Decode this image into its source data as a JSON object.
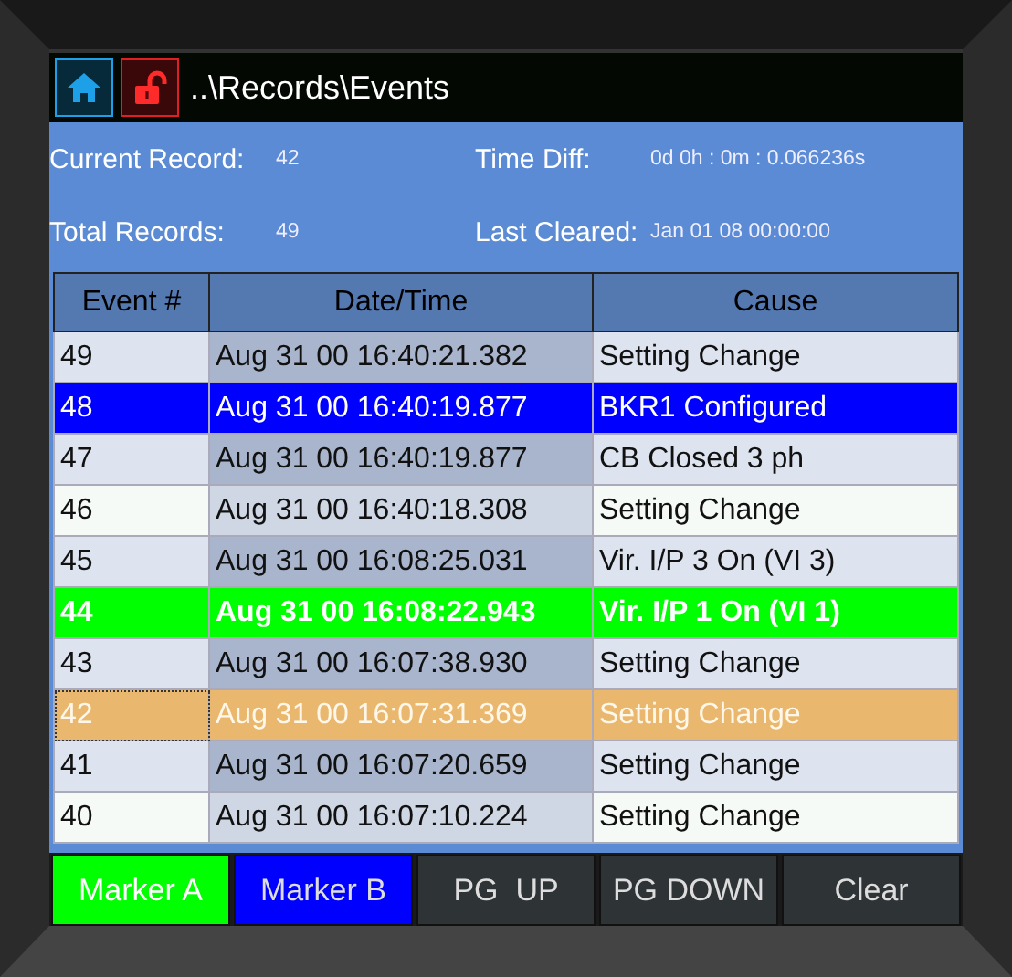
{
  "title_bar": {
    "path": "..\\Records\\Events",
    "locked": false
  },
  "info": [
    {
      "label": "Current Record:",
      "value": "42"
    },
    {
      "label": "Time Diff:",
      "value": "0d 0h : 0m : 0.066236s"
    },
    {
      "label": "Total Records:",
      "value": "49"
    },
    {
      "label": "Last Cleared:",
      "value": "Jan 01 08 00:00:00"
    }
  ],
  "table": {
    "columns": [
      "Event #",
      "Date/Time",
      "Cause"
    ],
    "rows": [
      {
        "cells": [
          "49",
          "Aug 31 00 16:40:21.382",
          "Setting Change"
        ],
        "marker_a": false,
        "marker_b": false,
        "selected": false
      },
      {
        "cells": [
          "48",
          "Aug 31 00 16:40:19.877",
          "BKR1 Configured"
        ],
        "marker_a": false,
        "marker_b": true,
        "selected": false
      },
      {
        "cells": [
          "47",
          "Aug 31 00 16:40:19.877",
          "CB Closed 3 ph"
        ],
        "marker_a": false,
        "marker_b": false,
        "selected": false
      },
      {
        "cells": [
          "46",
          "Aug 31 00 16:40:18.308",
          "Setting Change"
        ],
        "marker_a": false,
        "marker_b": false,
        "selected": false
      },
      {
        "cells": [
          "45",
          "Aug 31 00 16:08:25.031",
          "Vir. I/P 3 On (VI 3)"
        ],
        "marker_a": false,
        "marker_b": false,
        "selected": false
      },
      {
        "cells": [
          "44",
          "Aug 31 00 16:08:22.943",
          "Vir. I/P 1 On (VI 1)"
        ],
        "marker_a": true,
        "marker_b": false,
        "selected": false
      },
      {
        "cells": [
          "43",
          "Aug 31 00 16:07:38.930",
          "Setting Change"
        ],
        "marker_a": false,
        "marker_b": false,
        "selected": false
      },
      {
        "cells": [
          "42",
          "Aug 31 00 16:07:31.369",
          "Setting Change"
        ],
        "marker_a": false,
        "marker_b": false,
        "selected": true
      },
      {
        "cells": [
          "41",
          "Aug 31 00 16:07:20.659",
          "Setting Change"
        ],
        "marker_a": false,
        "marker_b": false,
        "selected": false
      },
      {
        "cells": [
          "40",
          "Aug 31 00 16:07:10.224",
          "Setting Change"
        ],
        "marker_a": false,
        "marker_b": false,
        "selected": false
      }
    ]
  },
  "buttons": [
    {
      "label": "Marker A",
      "kind": "a"
    },
    {
      "label": "Marker B",
      "kind": "b"
    },
    {
      "label": "PG  UP",
      "kind": "plain"
    },
    {
      "label": "PG DOWN",
      "kind": "plain"
    },
    {
      "label": "Clear",
      "kind": "plain"
    }
  ]
}
